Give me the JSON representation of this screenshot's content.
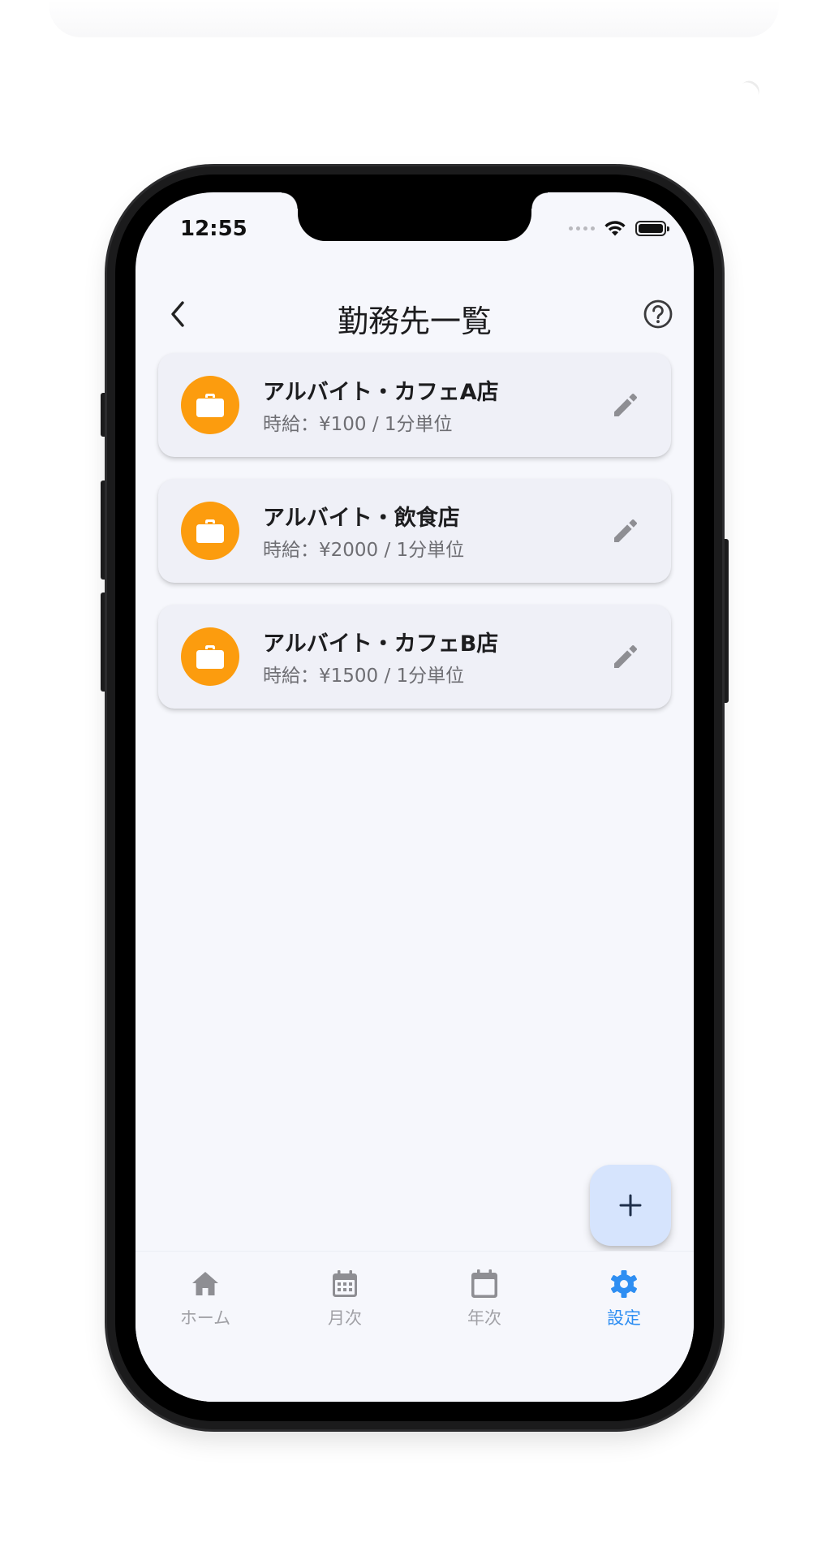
{
  "status_bar": {
    "time": "12:55"
  },
  "header": {
    "title": "勤務先一覧"
  },
  "workplaces": [
    {
      "name": "アルバイト・カフェA店",
      "detail": "時給：¥100 / 1分単位",
      "icon": "briefcase-icon"
    },
    {
      "name": "アルバイト・飲食店",
      "detail": "時給：¥2000 / 1分単位",
      "icon": "briefcase-icon"
    },
    {
      "name": "アルバイト・カフェB店",
      "detail": "時給：¥1500 / 1分単位",
      "icon": "briefcase-icon"
    }
  ],
  "fab": {
    "icon": "plus-icon"
  },
  "bottom_nav": [
    {
      "label": "ホーム",
      "icon": "home-icon",
      "active": false
    },
    {
      "label": "月次",
      "icon": "calendar-month-icon",
      "active": false
    },
    {
      "label": "年次",
      "icon": "calendar-icon",
      "active": false
    },
    {
      "label": "設定",
      "icon": "gear-icon",
      "active": true
    }
  ],
  "colors": {
    "accent": "#2e8ef2",
    "avatar": "#fc9c0e",
    "fab_background": "#d6e4fd",
    "screen_background": "#f6f7fc",
    "card_background": "#eff0f7"
  }
}
